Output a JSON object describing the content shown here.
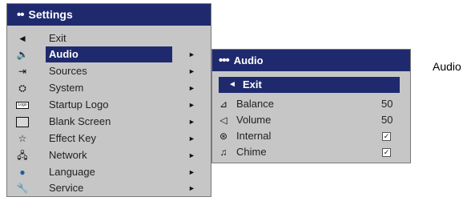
{
  "main_menu": {
    "title": "Settings",
    "title_dots": "••",
    "items": [
      {
        "label": "Exit",
        "icon": "◄",
        "arrow": ""
      },
      {
        "label": "Audio",
        "icon": "🔈",
        "arrow": "►"
      },
      {
        "label": "Sources",
        "icon": "⇥",
        "arrow": "►"
      },
      {
        "label": "System",
        "icon": "⛭",
        "arrow": "►"
      },
      {
        "label": "Startup Logo",
        "icon": "Logo",
        "arrow": "►"
      },
      {
        "label": "Blank Screen",
        "icon": "",
        "arrow": "►"
      },
      {
        "label": "Effect Key",
        "icon": "☆",
        "arrow": "►"
      },
      {
        "label": "Network",
        "icon": "🖧",
        "arrow": "►"
      },
      {
        "label": "Language",
        "icon": "●",
        "arrow": "►"
      },
      {
        "label": "Service",
        "icon": "🔧",
        "arrow": "►"
      }
    ]
  },
  "sub_menu": {
    "title": "Audio",
    "title_dots": "•••",
    "items": [
      {
        "label": "Exit",
        "icon": "◄"
      },
      {
        "label": "Balance",
        "icon": "⊿",
        "value": "50"
      },
      {
        "label": "Volume",
        "icon": "◁",
        "value": "50"
      },
      {
        "label": "Internal",
        "icon": "⊛",
        "checked": "☑"
      },
      {
        "label": "Chime",
        "icon": "♫",
        "checked": "☑"
      }
    ]
  },
  "caption": "Audio",
  "colors": {
    "title_bar": "#1f2a6e",
    "menu_bg": "#c6c6c6"
  }
}
